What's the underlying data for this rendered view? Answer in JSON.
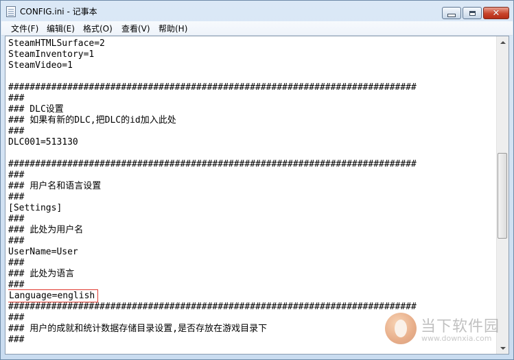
{
  "window": {
    "title": "CONFIG.ini - 记事本"
  },
  "menu": [
    {
      "label": "文件(F)"
    },
    {
      "label": "编辑(E)"
    },
    {
      "label": "格式(O)"
    },
    {
      "label": "查看(V)"
    },
    {
      "label": "帮助(H)"
    }
  ],
  "lines": [
    "SteamHTMLSurface=2",
    "SteamInventory=1",
    "SteamVideo=1",
    "",
    "############################################################################",
    "###",
    "### DLC设置",
    "### 如果有新的DLC,把DLC的id加入此处",
    "###",
    "DLC001=513130",
    "",
    "############################################################################",
    "###",
    "### 用户名和语言设置",
    "###",
    "[Settings]",
    "###",
    "### 此处为用户名",
    "###",
    "UserName=User",
    "###",
    "### 此处为语言",
    "###",
    "Language=english",
    "############################################################################",
    "###",
    "### 用户的成就和统计数据存储目录设置,是否存放在游戏目录下",
    "###"
  ],
  "highlighted_line_index": 23,
  "highlight_color": "#e0392f",
  "watermark": {
    "name": "当下软件园",
    "url": "www.downxia.com"
  }
}
